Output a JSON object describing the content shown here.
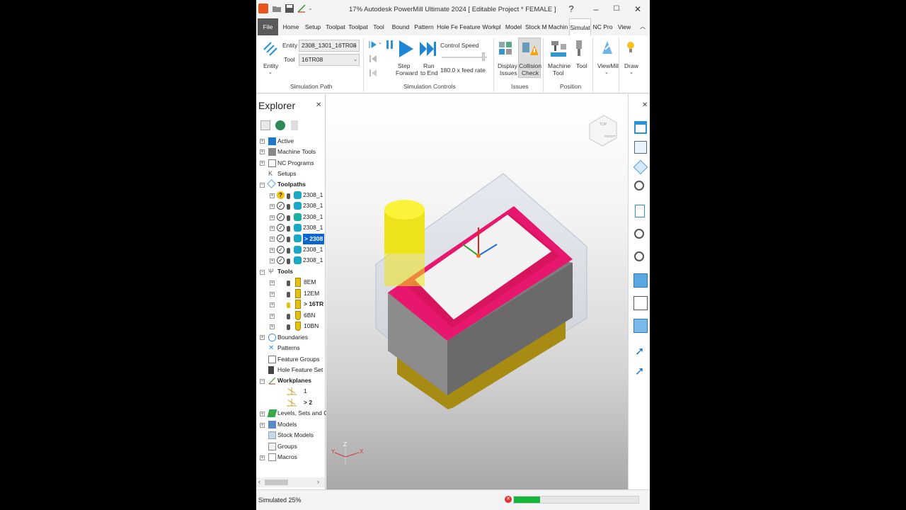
{
  "window": {
    "title": "17% Autodesk PowerMill Ultimate 2024    [ Editable Project * FEMALE ]",
    "help_icon": "question-circle-icon"
  },
  "tabs": [
    {
      "label": "File"
    },
    {
      "label": "Home"
    },
    {
      "label": "Setup"
    },
    {
      "label": "Toolpat"
    },
    {
      "label": "Toolpat"
    },
    {
      "label": "Tool"
    },
    {
      "label": "Bound"
    },
    {
      "label": "Pattern"
    },
    {
      "label": "Hole Fe"
    },
    {
      "label": "Feature"
    },
    {
      "label": "Workpl"
    },
    {
      "label": "Model"
    },
    {
      "label": "Stock M"
    },
    {
      "label": "Machin"
    },
    {
      "label": "Simulat"
    },
    {
      "label": "NC Pro"
    },
    {
      "label": "View"
    }
  ],
  "active_tab": "Simulat",
  "ribbon": {
    "entity_label": "Entity",
    "entity_field_label": "Entity",
    "entity_value": "2308_1301_16TR08",
    "tool_field_label": "Tool",
    "tool_value": "16TR08",
    "step_forward": "Step Forward",
    "step_forward_l1": "Step",
    "step_forward_l2": "Forward",
    "run_to_end_l1": "Run",
    "run_to_end_l2": "to End",
    "control_speed": "Control Speed",
    "feed_rate": "180.0 x feed rate",
    "display_issues_l1": "Display",
    "display_issues_l2": "Issues",
    "collision_check_l1": "Collision",
    "collision_check_l2": "Check",
    "machine_tool_l1": "Machine",
    "machine_tool_l2": "Tool",
    "tool": "Tool",
    "viewmill": "ViewMill",
    "draw": "Draw",
    "groups": {
      "simulation_path": "Simulation Path",
      "simulation_controls": "Simulation Controls",
      "issues": "Issues",
      "position": "Position"
    }
  },
  "explorer": {
    "title": "Explorer",
    "items": {
      "active": "Active",
      "machine_tools": "Machine Tools",
      "nc_programs": "NC Programs",
      "setups": "Setups",
      "toolpaths": "Toolpaths",
      "tp1": "2308_1",
      "tp2": "2308_1",
      "tp3": "2308_1",
      "tp4": "2308_1",
      "tp5": "> 2308",
      "tp6": "2308_1",
      "tp7": "2308_1",
      "tools": "Tools",
      "tool1": "8EM",
      "tool2": "12EM",
      "tool3": "> 16TR",
      "tool4": "6BN",
      "tool5": "10BN",
      "boundaries": "Boundaries",
      "patterns": "Patterns",
      "feature_groups": "Feature Groups",
      "hole_feature_sets": "Hole Feature Set",
      "workplanes": "Workplanes",
      "wp1": "1",
      "wp2": "> 2",
      "levels": "Levels, Sets and C",
      "models": "Models",
      "stock_models": "Stock Models",
      "groups": "Groups",
      "macros": "Macros"
    }
  },
  "viewport": {
    "axis_x": "X",
    "axis_y": "Y",
    "axis_z": "Z",
    "view_cube_top": "TOP",
    "view_cube_front": "FRONT",
    "colors": {
      "stock_pink": "#e8176e",
      "tool_yellow": "#f2ee1c",
      "stock_gray": "#8a8a8a",
      "base_gold": "#b89a1e"
    }
  },
  "status": {
    "text": "Simulated 25%",
    "progress_percent": 21,
    "progress_color": "#16b53a"
  }
}
